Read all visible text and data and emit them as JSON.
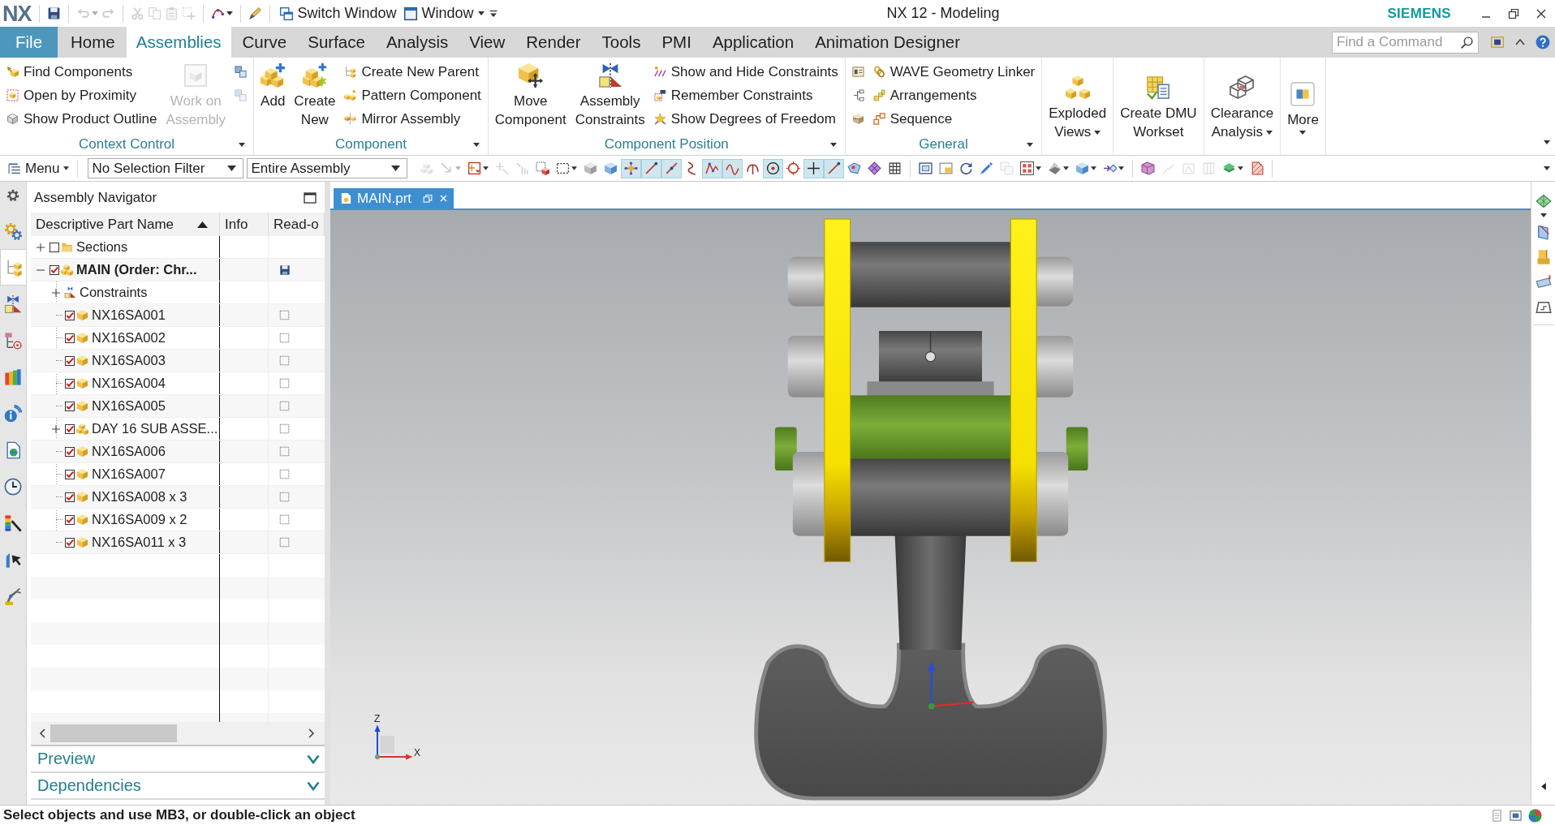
{
  "title_bar": {
    "logo": "NX",
    "quick_access": [
      {
        "disabled": false,
        "caret": false
      },
      {
        "disabled": true,
        "caret": true
      },
      {
        "disabled": true,
        "caret": false
      },
      {
        "disabled": true,
        "caret": false
      },
      {
        "disabled": true,
        "caret": false
      },
      {
        "disabled": true,
        "caret": false
      },
      {
        "disabled": true,
        "caret": false
      },
      {
        "disabled": false,
        "caret": true
      },
      {
        "disabled": false,
        "caret": false
      }
    ],
    "switch_window": "Switch Window",
    "window_menu": "Window",
    "title": "NX 12 - Modeling",
    "brand": "SIEMENS"
  },
  "menu_tabs": [
    {
      "label": "File",
      "kind": "file",
      "selected": false
    },
    {
      "label": "Home",
      "kind": "tab",
      "selected": false
    },
    {
      "label": "Assemblies",
      "kind": "tab",
      "selected": true
    },
    {
      "label": "Curve",
      "kind": "tab",
      "selected": false
    },
    {
      "label": "Surface",
      "kind": "tab",
      "selected": false
    },
    {
      "label": "Analysis",
      "kind": "tab",
      "selected": false
    },
    {
      "label": "View",
      "kind": "tab",
      "selected": false
    },
    {
      "label": "Render",
      "kind": "tab",
      "selected": false
    },
    {
      "label": "Tools",
      "kind": "tab",
      "selected": false
    },
    {
      "label": "PMI",
      "kind": "tab",
      "selected": false
    },
    {
      "label": "Application",
      "kind": "tab",
      "selected": false
    },
    {
      "label": "Animation Designer",
      "kind": "tab",
      "selected": false
    }
  ],
  "command_finder": {
    "placeholder": "Find a Command"
  },
  "ribbon": {
    "groups": [
      {
        "label": "Context Control",
        "columns": [
          {
            "kind": "stack",
            "items": [
              {
                "label": "Find Components",
                "disabled": false
              },
              {
                "label": "Open by Proximity",
                "disabled": false
              },
              {
                "label": "Show Product Outline",
                "disabled": false
              }
            ]
          },
          {
            "kind": "large",
            "label": "Work on Assembly",
            "disabled": true,
            "menu": false
          },
          {
            "kind": "icons",
            "items": [
              {
                "disabled": false
              },
              {
                "disabled": true
              }
            ]
          }
        ]
      },
      {
        "label": "Component",
        "columns": [
          {
            "kind": "large",
            "label": "Add",
            "disabled": false,
            "menu": false
          },
          {
            "kind": "large",
            "label": "Create New",
            "disabled": false,
            "menu": false
          },
          {
            "kind": "stack",
            "items": [
              {
                "label": "Create New Parent",
                "disabled": false
              },
              {
                "label": "Pattern Component",
                "disabled": false
              },
              {
                "label": "Mirror Assembly",
                "disabled": false
              }
            ]
          }
        ]
      },
      {
        "label": "Component Position",
        "columns": [
          {
            "kind": "large",
            "label": "Move Component",
            "disabled": false,
            "menu": false
          },
          {
            "kind": "large",
            "label": "Assembly Constraints",
            "disabled": false,
            "menu": false
          },
          {
            "kind": "stack",
            "items": [
              {
                "label": "Show and Hide Constraints",
                "disabled": false
              },
              {
                "label": "Remember Constraints",
                "disabled": false
              },
              {
                "label": "Show Degrees of Freedom",
                "disabled": false
              }
            ]
          }
        ]
      },
      {
        "label": "General",
        "columns": [
          {
            "kind": "icons",
            "items": [
              {
                "disabled": false
              },
              {
                "disabled": false
              },
              {
                "disabled": false
              }
            ]
          },
          {
            "kind": "stack",
            "items": [
              {
                "label": "WAVE Geometry Linker",
                "disabled": false
              },
              {
                "label": "Arrangements",
                "disabled": false
              },
              {
                "label": "Sequence",
                "disabled": false
              }
            ]
          }
        ]
      },
      {
        "columns": [
          {
            "kind": "large",
            "label": "Exploded Views",
            "disabled": false,
            "menu": true
          }
        ]
      },
      {
        "columns": [
          {
            "kind": "large",
            "label": "Create DMU Workset",
            "disabled": false,
            "menu": false
          }
        ]
      },
      {
        "columns": [
          {
            "kind": "large",
            "label": "Clearance Analysis",
            "disabled": false,
            "menu": true
          }
        ]
      },
      {
        "columns": [
          {
            "kind": "large",
            "label": "More",
            "disabled": false,
            "menu": true
          }
        ]
      }
    ]
  },
  "toolbar": {
    "menu": "Menu",
    "selection_filter": "No Selection Filter",
    "scope": "Entire Assembly",
    "tool_groups": [
      {
        "tools": [
          {
            "on": false,
            "disabled": true,
            "caret": false
          },
          {
            "on": false,
            "disabled": true,
            "caret": true
          },
          {
            "on": false,
            "disabled": false,
            "caret": true
          },
          {
            "on": false,
            "disabled": true,
            "caret": false
          },
          {
            "on": false,
            "disabled": true,
            "caret": false
          },
          {
            "on": false,
            "disabled": false,
            "caret": false
          },
          {
            "on": false,
            "disabled": false,
            "caret": true
          },
          {
            "on": false,
            "disabled": false,
            "caret": false
          },
          {
            "on": false,
            "disabled": false,
            "caret": false
          },
          {
            "on": true,
            "disabled": false,
            "caret": false
          },
          {
            "on": true,
            "disabled": false,
            "caret": false
          },
          {
            "on": true,
            "disabled": false,
            "caret": false
          },
          {
            "on": false,
            "disabled": false,
            "caret": false
          },
          {
            "on": true,
            "disabled": false,
            "caret": false
          },
          {
            "on": true,
            "disabled": false,
            "caret": false
          },
          {
            "on": false,
            "disabled": false,
            "caret": false
          },
          {
            "on": true,
            "disabled": false,
            "caret": false
          },
          {
            "on": false,
            "disabled": false,
            "caret": false
          },
          {
            "on": true,
            "disabled": false,
            "caret": false
          },
          {
            "on": true,
            "disabled": false,
            "caret": false
          },
          {
            "on": false,
            "disabled": false,
            "caret": false
          },
          {
            "on": false,
            "disabled": false,
            "caret": false
          },
          {
            "on": false,
            "disabled": false,
            "caret": false
          }
        ]
      },
      {
        "tools": [
          {
            "on": false,
            "disabled": false,
            "caret": false
          },
          {
            "on": false,
            "disabled": false,
            "caret": false
          },
          {
            "on": false,
            "disabled": false,
            "caret": false
          },
          {
            "on": false,
            "disabled": false,
            "caret": false
          },
          {
            "on": false,
            "disabled": true,
            "caret": false
          },
          {
            "on": false,
            "disabled": false,
            "caret": true
          },
          {
            "on": false,
            "disabled": false,
            "caret": true
          },
          {
            "on": false,
            "disabled": false,
            "caret": true
          },
          {
            "on": false,
            "disabled": false,
            "caret": true
          }
        ]
      },
      {
        "tools": [
          {
            "on": false,
            "disabled": false,
            "caret": false
          },
          {
            "on": false,
            "disabled": true,
            "caret": false
          },
          {
            "on": false,
            "disabled": true,
            "caret": false
          },
          {
            "on": false,
            "disabled": true,
            "caret": false
          },
          {
            "on": false,
            "disabled": false,
            "caret": true
          },
          {
            "on": false,
            "disabled": false,
            "caret": false
          }
        ]
      }
    ]
  },
  "resource_bar": [
    {
      "selected": false
    },
    {
      "selected": true
    },
    {
      "selected": false
    },
    {
      "selected": false
    },
    {
      "selected": false
    },
    {
      "selected": false
    },
    {
      "selected": false
    },
    {
      "selected": false
    },
    {
      "selected": false
    },
    {
      "selected": false
    },
    {
      "selected": false
    }
  ],
  "navigator": {
    "title": "Assembly Navigator",
    "columns": [
      {
        "label": "Descriptive Part Name",
        "sort_ascending": true
      },
      {
        "label": "Info"
      },
      {
        "label": "Read-o"
      }
    ],
    "rows": [
      {
        "name": "Sections",
        "kind": "folder",
        "expanded": false,
        "checked": false,
        "work_part": false,
        "modified": false
      },
      {
        "name": "MAIN (Order: Chr...",
        "kind": "assembly",
        "expanded": true,
        "checked": true,
        "work_part": true,
        "modified": true,
        "children": [
          {
            "name": "Constraints",
            "kind": "constraints",
            "expanded": false,
            "work_part": false,
            "modified": false
          },
          {
            "name": "NX16SA001",
            "kind": "part",
            "checked": true,
            "work_part": false,
            "modified": false
          },
          {
            "name": "NX16SA002",
            "kind": "part",
            "checked": true,
            "work_part": false,
            "modified": false
          },
          {
            "name": "NX16SA003",
            "kind": "part",
            "checked": true,
            "work_part": false,
            "modified": false
          },
          {
            "name": "NX16SA004",
            "kind": "part",
            "checked": true,
            "work_part": false,
            "modified": false
          },
          {
            "name": "NX16SA005",
            "kind": "part",
            "checked": true,
            "work_part": false,
            "modified": false
          },
          {
            "name": "DAY 16 SUB ASSE...",
            "kind": "assembly",
            "expanded": false,
            "checked": true,
            "work_part": false,
            "modified": false
          },
          {
            "name": "NX16SA006",
            "kind": "part",
            "checked": true,
            "work_part": false,
            "modified": false
          },
          {
            "name": "NX16SA007",
            "kind": "part",
            "checked": true,
            "work_part": false,
            "modified": false
          },
          {
            "name": "NX16SA008 x 3",
            "kind": "part",
            "checked": true,
            "work_part": false,
            "modified": false
          },
          {
            "name": "NX16SA009 x 2",
            "kind": "part",
            "checked": true,
            "work_part": false,
            "modified": false
          },
          {
            "name": "NX16SA011 x 3",
            "kind": "part",
            "checked": true,
            "work_part": false,
            "modified": false
          }
        ]
      }
    ],
    "sections": [
      {
        "label": "Preview",
        "expanded": false
      },
      {
        "label": "Dependencies",
        "expanded": false
      }
    ]
  },
  "graphics_window": {
    "tab": {
      "label": "MAIN.prt",
      "selected": true
    },
    "view_triad": {
      "z_label": "Z",
      "x_label": "X"
    }
  },
  "status_bar": {
    "message": "Select objects and use MB3, or double-click an object"
  }
}
